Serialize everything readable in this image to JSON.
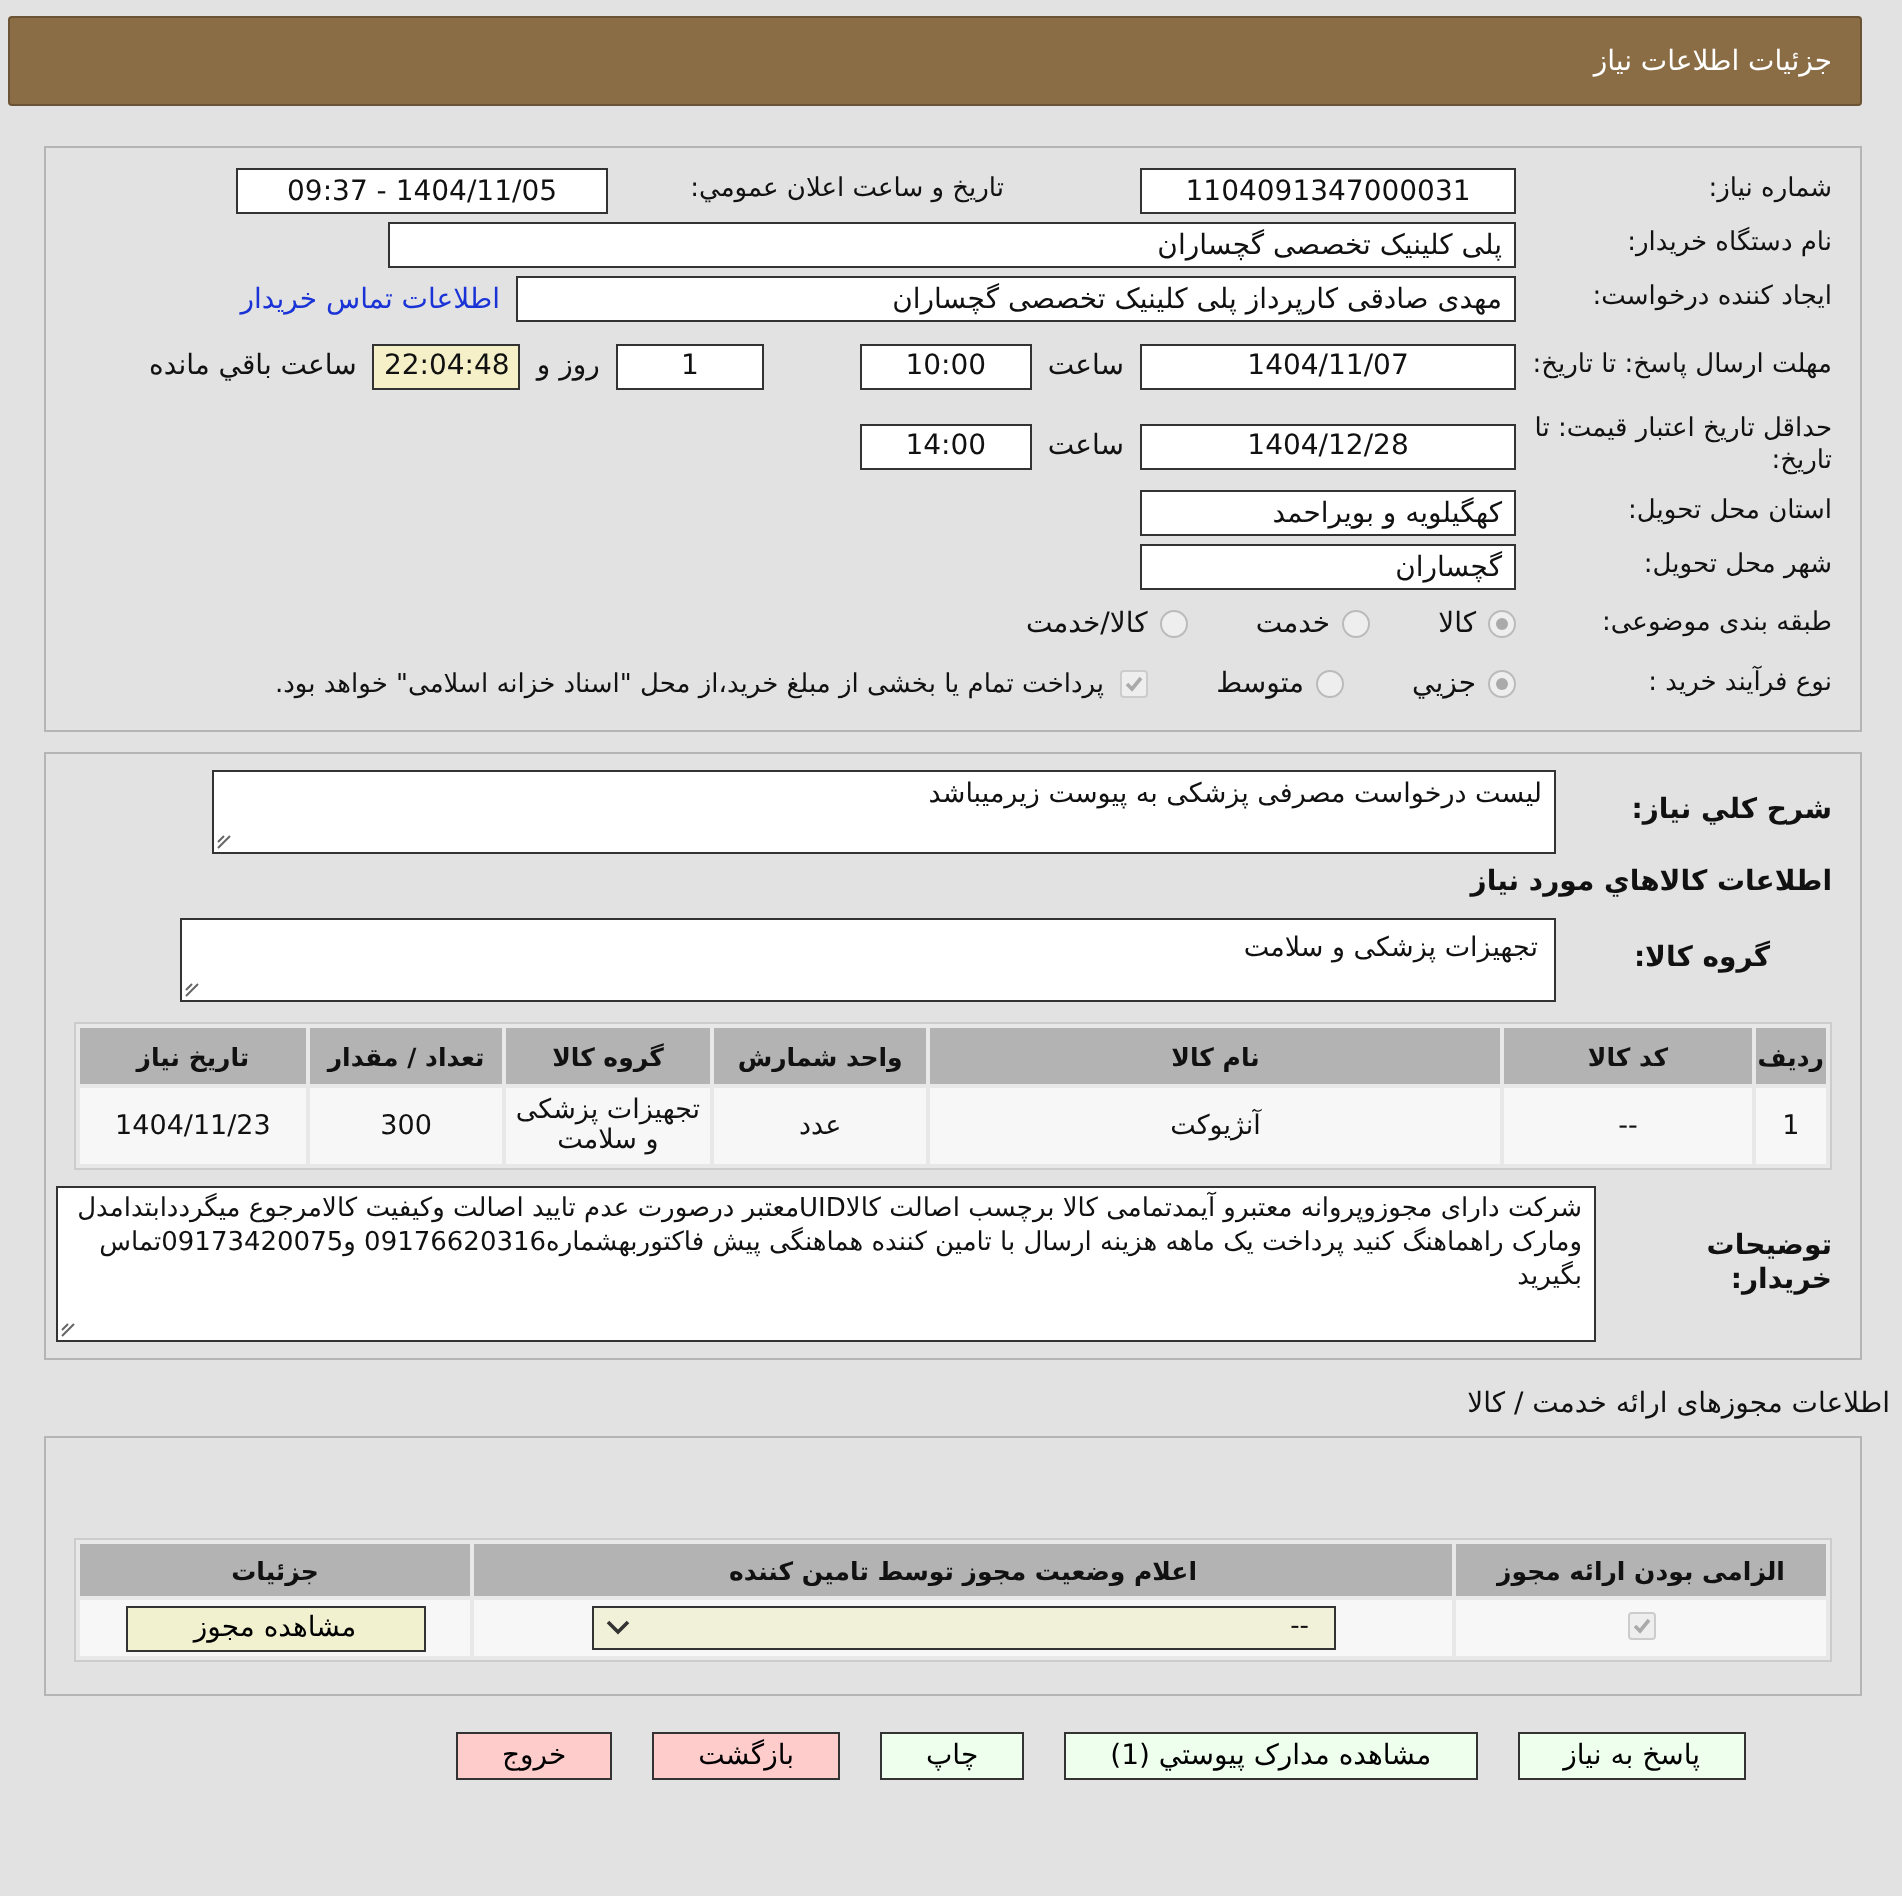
{
  "header": {
    "title": "جزئیات اطلاعات نیاز"
  },
  "need_number": {
    "label": "شماره نیاز:",
    "value": "1104091347000031"
  },
  "announce": {
    "label": "تاریخ و ساعت اعلان عمومي:",
    "value": "1404/11/05 - 09:37"
  },
  "buyer_org": {
    "label": "نام دستگاه خريدار:",
    "value": "پلی کلینیک تخصصی گچساران"
  },
  "requester": {
    "label": "ایجاد کننده درخواست:",
    "value": "مهدی صادقی کارپرداز پلی کلینیک تخصصی گچساران",
    "link": "اطلاعات تماس خریدار"
  },
  "reply_deadline": {
    "label": "مهلت ارسال پاسخ: تا تاریخ:",
    "date": "1404/11/07",
    "time_label": "ساعت",
    "time": "10:00",
    "days": "1",
    "days_label": "روز و",
    "remaining": "22:04:48",
    "remaining_label": "ساعت باقي مانده"
  },
  "price_validity": {
    "label": "حداقل تاریخ اعتبار قیمت: تا تاریخ:",
    "date": "1404/12/28",
    "time_label": "ساعت",
    "time": "14:00"
  },
  "province": {
    "label": "استان محل تحویل:",
    "value": "کهگیلویه و بویراحمد"
  },
  "city": {
    "label": "شهر محل تحویل:",
    "value": "گچساران"
  },
  "category": {
    "label": "طبقه بندی موضوعی:",
    "options": [
      {
        "label": "کالا",
        "selected": true
      },
      {
        "label": "خدمت",
        "selected": false
      },
      {
        "label": "کالا/خدمت",
        "selected": false
      }
    ]
  },
  "process": {
    "label": "نوع فرآیند خرید :",
    "options": [
      {
        "label": "جزیي",
        "selected": true
      },
      {
        "label": "متوسط",
        "selected": false
      }
    ],
    "payment": {
      "label": "پرداخت تمام یا بخشی از مبلغ خرید،از محل \"اسناد خزانه اسلامی\" خواهد بود.",
      "checked": true
    }
  },
  "summary": {
    "label": "شرح کلي نیاز:",
    "value": "لیست درخواست مصرفی پزشکی به پیوست زیرمیباشد"
  },
  "goods_title": "اطلاعات کالاهاي مورد نیاز",
  "goods_group": {
    "label": "گروه کالا:",
    "value": "تجهیزات پزشکی و سلامت"
  },
  "items": {
    "columns": [
      "ردیف",
      "کد کالا",
      "نام کالا",
      "واحد شمارش",
      "گروه کالا",
      "تعداد / مقدار",
      "تاریخ نیاز"
    ],
    "rows": [
      [
        "1",
        "--",
        "آنژیوکت",
        "عدد",
        "تجهیزات پزشکی و سلامت",
        "300",
        "1404/11/23"
      ]
    ]
  },
  "buyer_notes": {
    "label": "توضیحات خریدار:",
    "value": "شرکت دارای مجوزوپروانه معتبرو آیمدتمامی کالا برچسب اصالت کالاUIDمعتبر درصورت عدم تایید اصالت وکیفیت کالامرجوع میگرددابتدامدل ومارک راهماهنگ کنید پرداخت یک ماهه هزینه ارسال با تامین کننده هماهنگی پیش فاکتوربهشماره09176620316 و09173420075تماس بگیرید"
  },
  "permits": {
    "title": "اطلاعات مجوزهای ارائه خدمت / کالا",
    "columns": [
      "الزامی بودن ارائه مجوز",
      "اعلام وضعیت مجوز توسط تامین کننده",
      "جزئیات"
    ],
    "rows": [
      {
        "required": true,
        "status": "--",
        "action": "مشاهده مجوز"
      }
    ]
  },
  "buttons": [
    {
      "label": "پاسخ به نیاز",
      "color": "#eeffee"
    },
    {
      "label": "مشاهده مدارک پیوستي (1)",
      "color": "#eeffee"
    },
    {
      "label": "چاپ",
      "color": "#eeffee"
    },
    {
      "label": "بازگشت",
      "color": "#ffcccc"
    },
    {
      "label": "خروج",
      "color": "#ffcccc"
    }
  ]
}
